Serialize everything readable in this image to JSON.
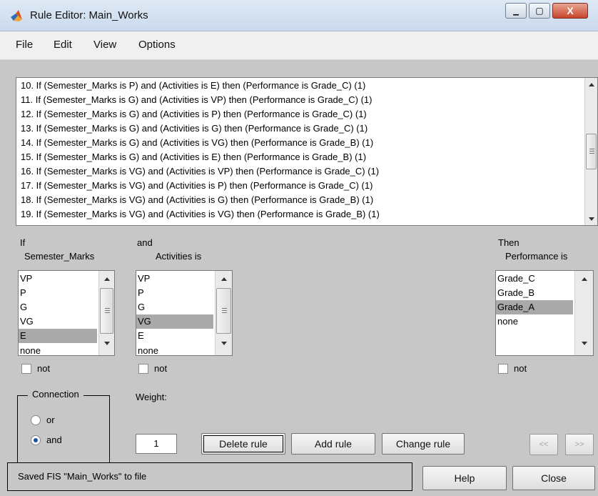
{
  "window": {
    "title": "Rule Editor: Main_Works",
    "minimize_symbol": "▁",
    "maximize_symbol": "▢",
    "close_symbol": "X"
  },
  "menu": [
    "File",
    "Edit",
    "View",
    "Options"
  ],
  "rules": [
    "10. If (Semester_Marks is P) and (Activities is E) then (Performance is Grade_C) (1)",
    "11. If (Semester_Marks is G) and (Activities is VP) then (Performance is Grade_C) (1)",
    "12. If (Semester_Marks is G) and (Activities is P) then (Performance is Grade_C) (1)",
    "13. If (Semester_Marks is G) and (Activities is G) then (Performance is Grade_C) (1)",
    "14. If (Semester_Marks is G) and (Activities is VG) then (Performance is Grade_B) (1)",
    "15. If (Semester_Marks is G) and (Activities is E) then (Performance is Grade_B) (1)",
    "16. If (Semester_Marks is VG) and (Activities is VP) then (Performance is Grade_C) (1)",
    "17. If (Semester_Marks is VG) and (Activities is P) then (Performance is Grade_C) (1)",
    "18. If (Semester_Marks is VG) and (Activities is G) then (Performance is Grade_B) (1)",
    "19. If (Semester_Marks is VG) and (Activities is VG) then (Performance is Grade_B) (1)"
  ],
  "antecedent1": {
    "prefix": "If",
    "title": "Semester_Marks",
    "options": [
      "VP",
      "P",
      "G",
      "VG",
      "E",
      "none"
    ],
    "selected": "E",
    "not_label": "not"
  },
  "antecedent2": {
    "prefix": "and",
    "title": "Activities is",
    "options": [
      "VP",
      "P",
      "G",
      "VG",
      "E",
      "none"
    ],
    "selected": "VG",
    "not_label": "not"
  },
  "consequent": {
    "prefix": "Then",
    "title": "Performance is",
    "options": [
      "Grade_C",
      "Grade_B",
      "Grade_A",
      "none"
    ],
    "selected": "Grade_A",
    "not_label": "not"
  },
  "connection": {
    "title": "Connection",
    "options": [
      "or",
      "and"
    ],
    "selected": "and"
  },
  "weight": {
    "label": "Weight:",
    "value": "1"
  },
  "buttons": {
    "delete": "Delete rule",
    "add": "Add rule",
    "change": "Change rule",
    "prev": "<<",
    "next": ">>",
    "help": "Help",
    "close": "Close"
  },
  "status": "Saved FIS \"Main_Works\" to file",
  "colors": {
    "panel": "#c7c7c7",
    "selection": "#a9a9a9",
    "titlebar": "#c9d9ec",
    "close_button": "#c7462b"
  }
}
